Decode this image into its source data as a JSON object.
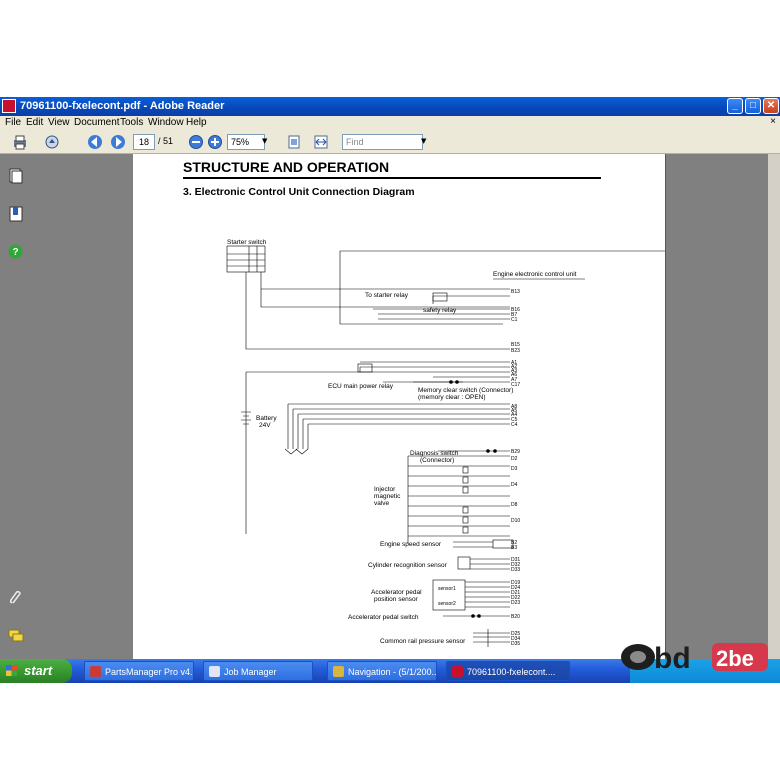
{
  "window": {
    "title": "70961100-fxelecont.pdf - Adobe Reader",
    "min": "_",
    "max": "□",
    "close": "✕"
  },
  "menu": [
    "File",
    "Edit",
    "View",
    "Document",
    "Tools",
    "Window",
    "Help"
  ],
  "menu_close": "×",
  "toolbar": {
    "page_current": "18",
    "page_total": "/ 51",
    "zoom": "75%",
    "find_placeholder": "Find"
  },
  "document": {
    "heading": "STRUCTURE AND OPERATION",
    "section": "3.  Electronic Control Unit Connection Diagram",
    "labels": {
      "starter_switch": "Starter switch",
      "ecu": "Engine electronic control unit",
      "to_starter_relay": "To starter relay",
      "safety_relay": "safety relay",
      "ecu_main_power_relay": "ECU main power relay",
      "memory_clear_1": "Memory clear switch (Connector)",
      "memory_clear_2": "(memory clear : OPEN)",
      "battery_1": "Battery",
      "battery_2": "24V",
      "diag_1": "Diagnosis switch",
      "diag_2": "(Connector)",
      "injector_1": "Injector",
      "injector_2": "magnetic",
      "injector_3": "valve",
      "engine_speed": "Engine speed sensor",
      "cyl_recog": "Cylinder recognition sensor",
      "accel_1": "Accelerator pedal",
      "accel_2": "position sensor",
      "sensor1": "sensor1",
      "sensor2": "sensor2",
      "accel_switch": "Accelerator pedal switch",
      "rail_pressure": "Common rail pressure sensor"
    },
    "pins": [
      "B13",
      "B16",
      "B7",
      "C1",
      "B15",
      "B23",
      "A1",
      "A2",
      "A3",
      "A6",
      "A7",
      "C17",
      "A8",
      "A5",
      "A4",
      "C5",
      "C4",
      "B29",
      "D2",
      "D3",
      "D4",
      "D8",
      "D10",
      "B2",
      "B3",
      "D31",
      "D32",
      "D33",
      "D19",
      "D24",
      "D21",
      "D22",
      "D23",
      "B20",
      "D25",
      "D34",
      "D35"
    ]
  },
  "taskbar": {
    "start": "start",
    "tasks": [
      "PartsManager Pro v4...",
      "Job Manager",
      "Navigation - (5/1/200...",
      "70961100-fxelecont...."
    ]
  },
  "watermark": {
    "text": "OBD2be"
  }
}
